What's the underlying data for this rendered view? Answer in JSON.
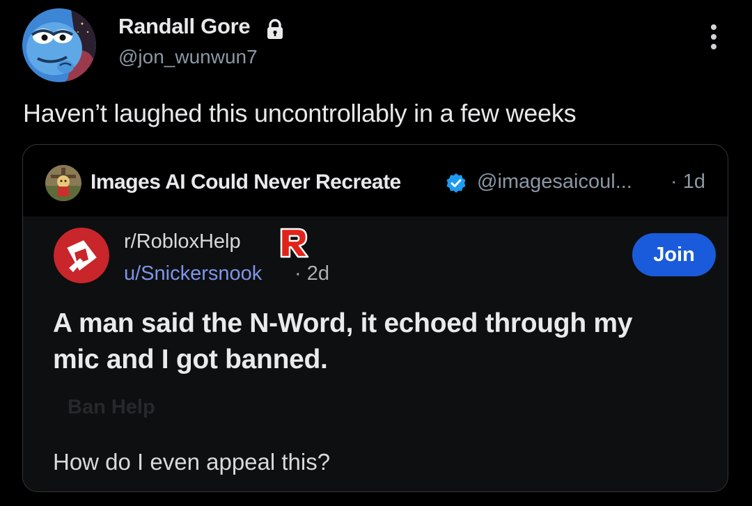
{
  "tweet": {
    "author": {
      "display_name": "Randall Gore",
      "handle": "@jon_wunwun7",
      "protected_icon": "lock-icon",
      "avatar_icon": "pepe-avatar"
    },
    "menu_icon": "more-vertical-icon",
    "text": "Haven’t laughed this uncontrollably in a few weeks"
  },
  "quoted_tweet": {
    "author": {
      "display_name": "Images AI Could Never Recreate",
      "handle": "@imagesaicoul...",
      "verified_icon": "verified-badge-icon",
      "avatar_icon": "quote-author-avatar"
    },
    "time": "· 1d",
    "reddit_post": {
      "subreddit": "r/RobloxHelp",
      "username": "u/Snickersnook",
      "time": "· 2d",
      "join_label": "Join",
      "title": "A man said the N-Word, it echoed through my mic and I got banned.",
      "flair": "Ban Help",
      "body": "How do I even appeal this?"
    }
  },
  "colors": {
    "background": "#000000",
    "text_primary": "#e7e9ea",
    "text_secondary": "#8b98a5",
    "verified_blue": "#1d9bf0",
    "reddit_join": "#1a5bdb",
    "reddit_username": "#7e95e8",
    "roblox_red": "#e2231a"
  }
}
